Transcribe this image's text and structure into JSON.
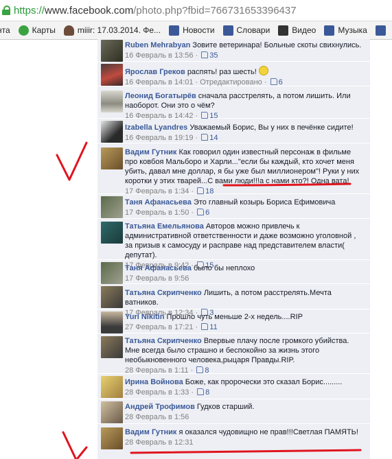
{
  "browser": {
    "url_scheme": "https://",
    "url_domain": "www.facebook.com",
    "url_rest": "/photo.php?fbid=766731653396437"
  },
  "bookmarks": [
    {
      "label": "нта",
      "color": "#ffffff"
    },
    {
      "label": "Карты",
      "color": "#3aa340"
    },
    {
      "label": "miiir: 17.03.2014. Фе...",
      "color": "#3b5998"
    },
    {
      "label": "Новости",
      "color": "#3b5998"
    },
    {
      "label": "Словари",
      "color": "#3b5998"
    },
    {
      "label": "Видео",
      "color": "#333333"
    },
    {
      "label": "Музыка",
      "color": "#3b5998"
    },
    {
      "label": "",
      "color": "#3b5998"
    }
  ],
  "comments": [
    {
      "author": "Ruben Mehrabyan",
      "text": "Зовите ветеринара! Больные скоты свихнулись.",
      "time": "16 Февраль в 13:56",
      "likes": "35"
    },
    {
      "author": "Ярослав Греков",
      "text": "распять! раз шесть!",
      "time": "16 Февраль в 14:01 · Отредактировано",
      "likes": "6"
    },
    {
      "author": "Леонид Богатырёв",
      "text": "сначала расстрелять, а потом лишить. Или наоборот. Они это о чём?",
      "time": "16 Февраль в 14:42",
      "likes": "15"
    },
    {
      "author": "Izabella Lyandres",
      "text": "Уважаемый Борис, Вы у них в печёнке сидите!",
      "time": "16 Февраль в 19:19",
      "likes": "14"
    },
    {
      "author": "Вадим Гутник",
      "text": "Как говорил один известный персонаж в фильме про ковбоя Мальборо и Харли...\"если бы каждый, кто хочет меня убить, давал мне доллар, я бы уже был миллионером\"! Руки у них коротки у этих тварей...С вами люди!!!а с нами кто?! Одна вата!",
      "time": "17 Февраль в 1:34",
      "likes": "18"
    },
    {
      "author": "Таня Афанасьева",
      "text": "Это главный козырь Бориса Ефимовича",
      "time": "17 Февраль в 1:50",
      "likes": "6"
    },
    {
      "author": "Татьяна Емельянова",
      "text": "Авторов можно привлечь к административной ответственности и даже возможно уголовной , за призыв к самосуду и расправе над представителем власти( депутат).",
      "time": "17 Февраль в 9:42",
      "likes": "15"
    },
    {
      "author": "Таня Афанасьева",
      "text": "было бы неплохо",
      "time": "17 Февраль в 9:56",
      "likes": ""
    },
    {
      "author": "Татьяна Скрипченко",
      "text": "Лишить, а потом расстрелять.Мечта ватников.",
      "time": "17 Февраль в 12:34",
      "likes": "3"
    },
    {
      "author": "Yuri Nikitin",
      "text": "Прошло чуть меньше 2-х недель....RIP",
      "time": "27 Февраль в 17:21",
      "likes": "11"
    },
    {
      "author": "Татьяна Скрипченко",
      "text": "Впервые плачу после громкого убийства. Мне всегда было страшно и беспокойно за жизнь этого необыкновенного человека,рыцаря Правды.RIP.",
      "time": "28 Февраль в 1:11",
      "likes": "8"
    },
    {
      "author": "Ирина Войнова",
      "text": "Боже, как пророчески это сказал Борис.........",
      "time": "28 Февраль в 1:33",
      "likes": "8"
    },
    {
      "author": "Андрей Трофимов",
      "text": "Гудков старший.",
      "time": "28 Февраль в 1:56",
      "likes": ""
    },
    {
      "author": "Вадим Гутник",
      "text": "я оказался чудовищно не прав!!!Светлая ПАМЯТЬ!",
      "time": "28 Февраль в 12:31",
      "likes": ""
    }
  ],
  "annotations": {
    "mark_color": "#e0141e"
  }
}
